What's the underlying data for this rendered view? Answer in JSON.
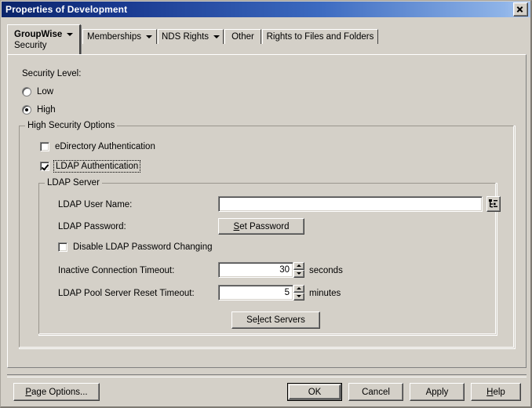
{
  "window": {
    "title": "Properties of Development",
    "close_icon": "close-icon"
  },
  "tabs": [
    {
      "label": "GroupWise",
      "sublabel": "Security",
      "active": true,
      "has_dropdown": true
    },
    {
      "label": "Memberships",
      "active": false,
      "has_dropdown": true
    },
    {
      "label": "NDS Rights",
      "active": false,
      "has_dropdown": true
    },
    {
      "label": "Other",
      "active": false,
      "has_dropdown": false
    },
    {
      "label": "Rights to Files and Folders",
      "active": false,
      "has_dropdown": false
    }
  ],
  "content": {
    "security_level_label": "Security Level:",
    "radios": [
      {
        "label": "Low",
        "selected": false
      },
      {
        "label": "High",
        "selected": true
      }
    ],
    "high_security_options": {
      "title": "High Security Options",
      "checkboxes": [
        {
          "label": "eDirectory Authentication",
          "checked": false,
          "focused": false
        },
        {
          "label": "LDAP Authentication",
          "checked": true,
          "focused": true
        }
      ],
      "ldap_server": {
        "title": "LDAP Server",
        "user_name_label": "LDAP User Name:",
        "user_name_value": "",
        "browse_icon": "directory-tree-icon",
        "password_label": "LDAP Password:",
        "set_password_button": "Set Password",
        "set_password_accesskey": "S",
        "disable_password_changing_label": "Disable LDAP Password Changing",
        "disable_password_changing_checked": false,
        "inactive_timeout_label": "Inactive Connection Timeout:",
        "inactive_timeout_value": "30",
        "inactive_timeout_units": "seconds",
        "pool_reset_label": "LDAP Pool Server Reset Timeout:",
        "pool_reset_value": "5",
        "pool_reset_units": "minutes",
        "select_servers_button": "Select Servers",
        "select_servers_accesskey": "l"
      }
    }
  },
  "footer": {
    "page_options": "Page Options...",
    "page_options_accesskey": "P",
    "ok": "OK",
    "cancel": "Cancel",
    "apply": "Apply",
    "help": "Help",
    "help_accesskey": "H"
  },
  "colors": {
    "face": "#d4d0c8",
    "title_dark": "#0a246a",
    "title_light": "#a9c7f0",
    "field": "#ffffff",
    "text": "#000000"
  }
}
